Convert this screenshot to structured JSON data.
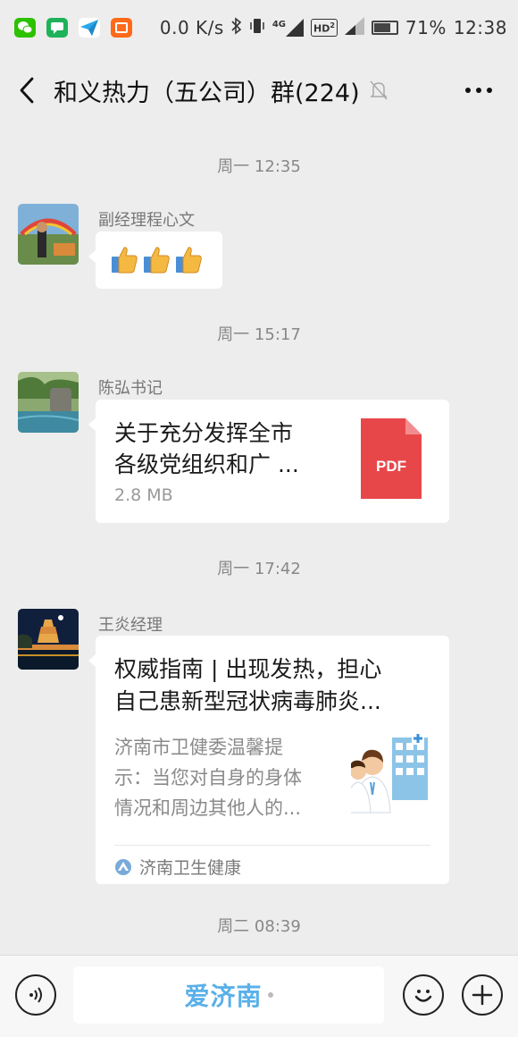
{
  "status_bar": {
    "net_speed": "0.0 K/s",
    "network": "4G",
    "hd": "HD",
    "hd_sup": "2",
    "battery": "71%",
    "battery_level": 0.71,
    "time": "12:38",
    "app_icons": [
      "wechat-icon",
      "chat-bubble-icon",
      "paper-plane-icon",
      "mi-icon"
    ]
  },
  "header": {
    "back_icon": "chevron-left-icon",
    "title": "和义热力（五公司）群(224)",
    "mute_icon": "bell-off-icon",
    "more_icon": "more-dots-icon"
  },
  "messages": [
    {
      "time": "周一 12:35",
      "sender": "副经理程心文",
      "type": "emoji",
      "content": "👍👍👍"
    },
    {
      "time": "周一 15:17",
      "sender": "陈弘书记",
      "type": "file",
      "title_line1": "关于充分发挥全市",
      "title_line2": "各级党组织和广 ...",
      "size": "2.8 MB",
      "file_badge": "PDF"
    },
    {
      "time": "周一 17:42",
      "sender": "王炎经理",
      "type": "article",
      "title_line1": "权威指南 | 出现发热，担心",
      "title_line2": "自己患新型冠状病毒肺炎...",
      "desc_line1": "济南市卫健委温馨提",
      "desc_line2": "示：当您对自身的身体",
      "desc_line3": "情况和周边其他人的...",
      "source": "济南卫生健康"
    },
    {
      "time": "周二 08:39"
    }
  ],
  "input_bar": {
    "voice_icon": "voice-icon",
    "input_text": "爱济南",
    "emoji_icon": "smiley-icon",
    "add_icon": "plus-icon"
  },
  "colors": {
    "background": "#ededed",
    "pdf_red": "#e8474a",
    "input_brand": "#5ab0e8"
  }
}
